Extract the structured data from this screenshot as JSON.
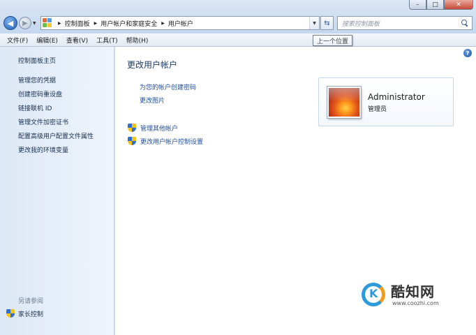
{
  "window": {
    "controls": {
      "minimize": "–",
      "maximize": "□",
      "close": "✕"
    }
  },
  "address_bar": {
    "breadcrumbs": [
      "控制面板",
      "用户帐户和家庭安全",
      "用户帐户"
    ],
    "search_placeholder": "搜索控制面板"
  },
  "menu": {
    "items": [
      "文件(F)",
      "编辑(E)",
      "查看(V)",
      "工具(T)",
      "帮助(H)"
    ]
  },
  "tooltip": "上一个位置",
  "sidebar": {
    "home": "控制面板主页",
    "items": [
      "管理您的凭据",
      "创建密码重设盘",
      "链接联机 ID",
      "管理文件加密证书",
      "配置高级用户配置文件属性",
      "更改我的环境变量"
    ],
    "see_also": "另请参阅",
    "family_safety": "家长控制"
  },
  "main": {
    "title": "更改用户帐户",
    "links": [
      "为您的帐户创建密码",
      "更改图片"
    ],
    "uac_links": [
      "管理其他帐户",
      "更改用户帐户控制设置"
    ]
  },
  "user": {
    "name": "Administrator",
    "role": "管理员"
  },
  "watermark": {
    "title": "酷知网",
    "url": "www.coozhi.com"
  },
  "colors": {
    "link": "#1c4fa0",
    "title": "#1e3a66",
    "sidebar_bg": "#dde8f6"
  }
}
